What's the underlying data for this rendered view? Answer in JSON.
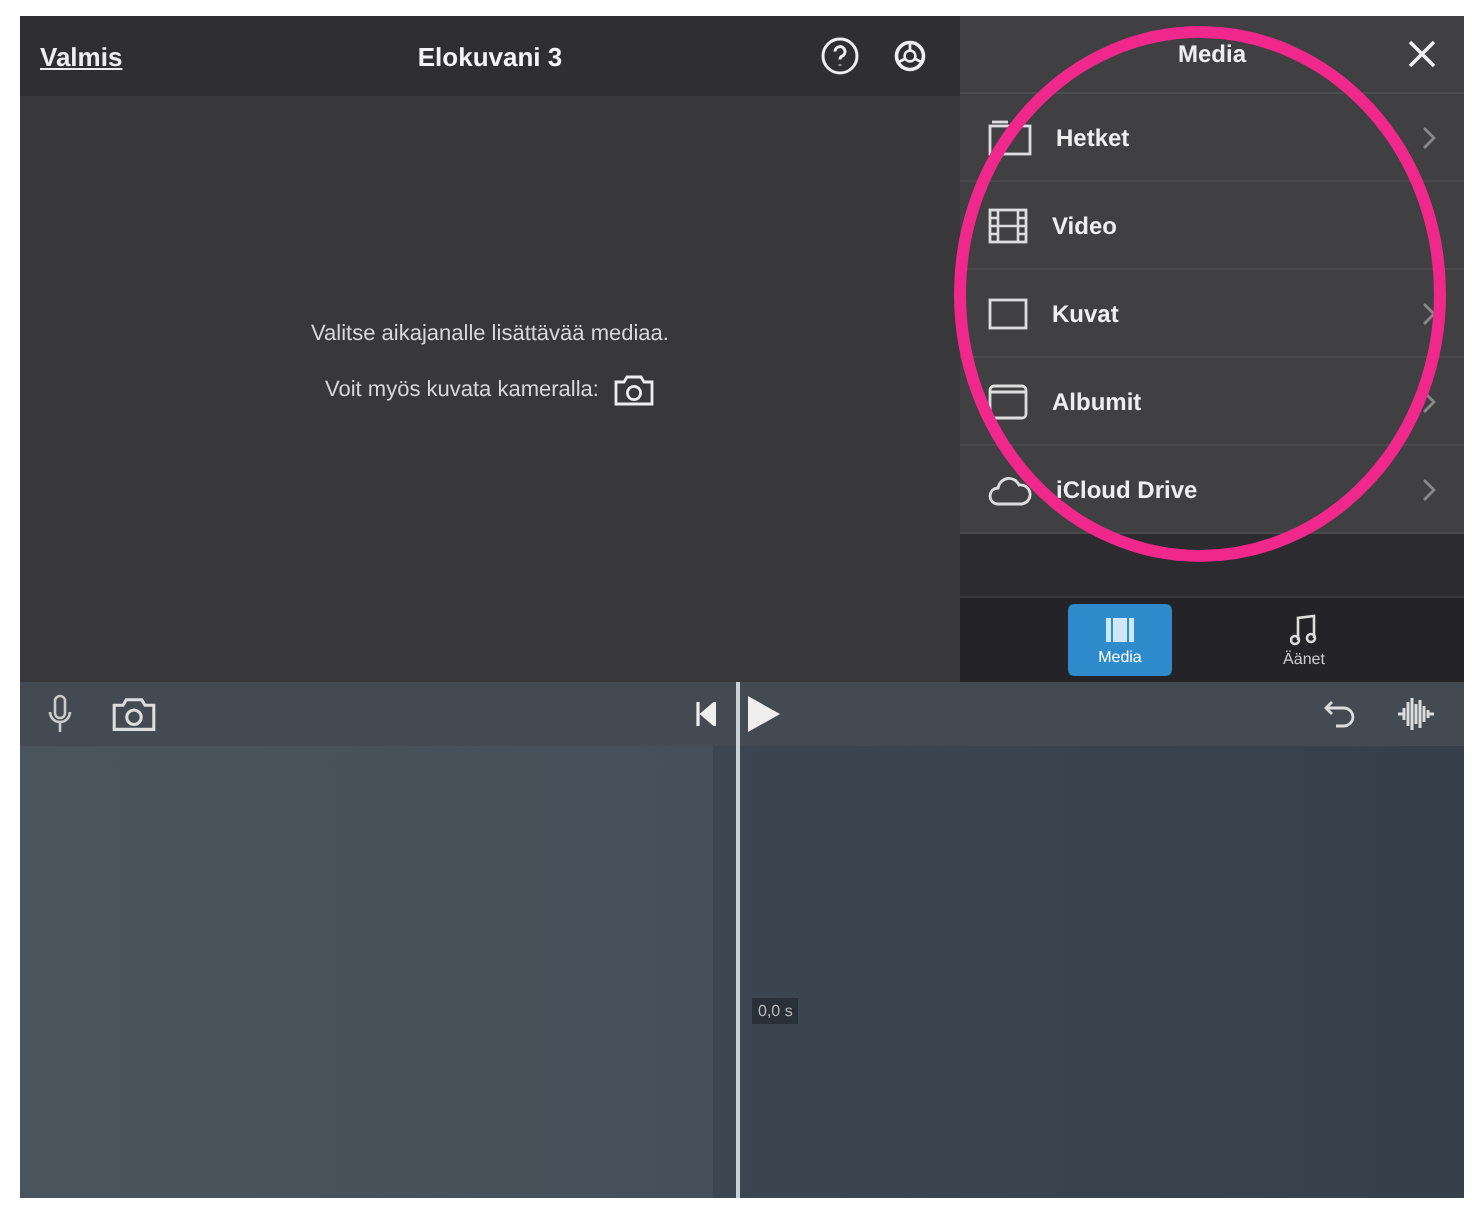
{
  "top_bar": {
    "done_link": "Valmis",
    "title": "Elokuvani 3"
  },
  "preview": {
    "message": "Valitse aikajanalle lisättävää mediaa.",
    "camera_hint": "Voit myös kuvata kameralla:"
  },
  "media_panel": {
    "title": "Media",
    "items": [
      {
        "kind": "moments",
        "label": "Hetket",
        "chevron": true
      },
      {
        "kind": "video",
        "label": "Video",
        "chevron": false
      },
      {
        "kind": "photos",
        "label": "Kuvat",
        "chevron": true
      },
      {
        "kind": "albums",
        "label": "Albumit",
        "chevron": true
      },
      {
        "kind": "cloud",
        "label": "iCloud Drive",
        "chevron": true
      }
    ],
    "tabs": [
      {
        "kind": "media",
        "label": "Media",
        "selected": true
      },
      {
        "kind": "audio",
        "label": "Äänet",
        "selected": false
      }
    ]
  },
  "timeline": {
    "playhead_time": "0,0 s"
  },
  "annotation": {
    "kind": "circle",
    "color": "#f0288c"
  }
}
